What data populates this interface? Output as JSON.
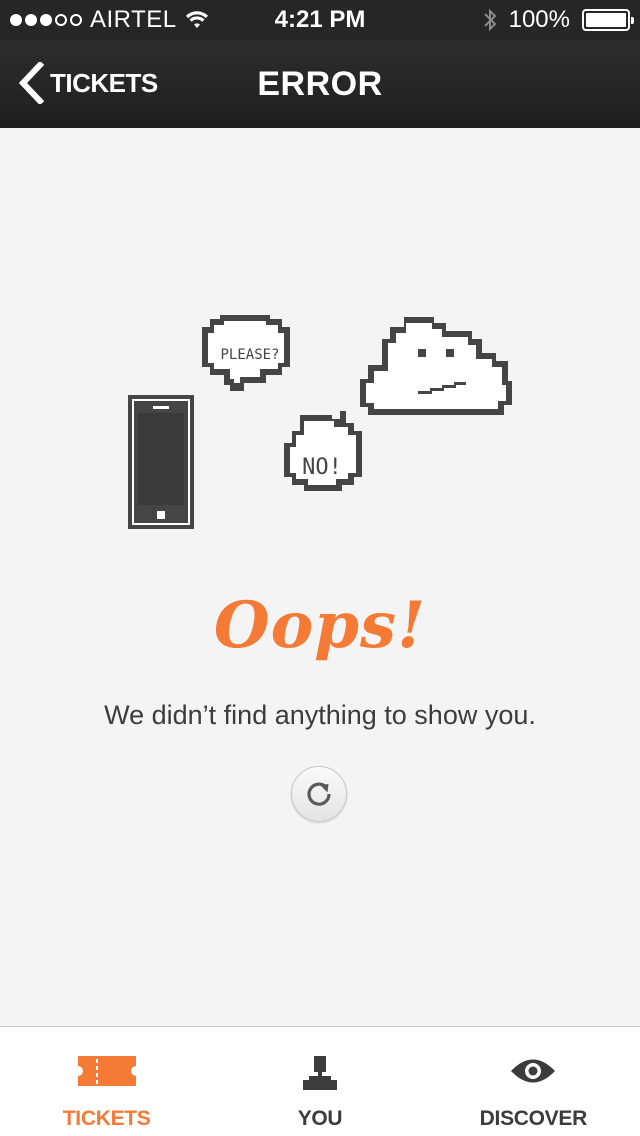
{
  "status_bar": {
    "carrier": "AIRTEL",
    "time": "4:21 PM",
    "battery_text": "100%",
    "battery_level": 1.0,
    "signal_bars_filled": 3,
    "signal_bars_total": 5,
    "icons": [
      "signal-dots",
      "wifi-icon",
      "bluetooth-icon",
      "battery-icon"
    ]
  },
  "nav_bar": {
    "back_label": "TICKETS",
    "title": "ERROR"
  },
  "illustration": {
    "bubble_please": "PLEASE?",
    "bubble_no": "NO!"
  },
  "content": {
    "heading": "Oops!",
    "message": "We didn’t find anything to show you.",
    "refresh_icon": "refresh-icon"
  },
  "tab_bar": {
    "tabs": [
      {
        "label": "TICKETS",
        "icon": "ticket-icon",
        "active": true
      },
      {
        "label": "YOU",
        "icon": "person-icon",
        "active": false
      },
      {
        "label": "DISCOVER",
        "icon": "eye-icon",
        "active": false
      }
    ]
  },
  "colors": {
    "accent": "#f47a35",
    "bar_dark": "#262626",
    "background": "#f4f4f4",
    "pixel_art": "#454545"
  }
}
